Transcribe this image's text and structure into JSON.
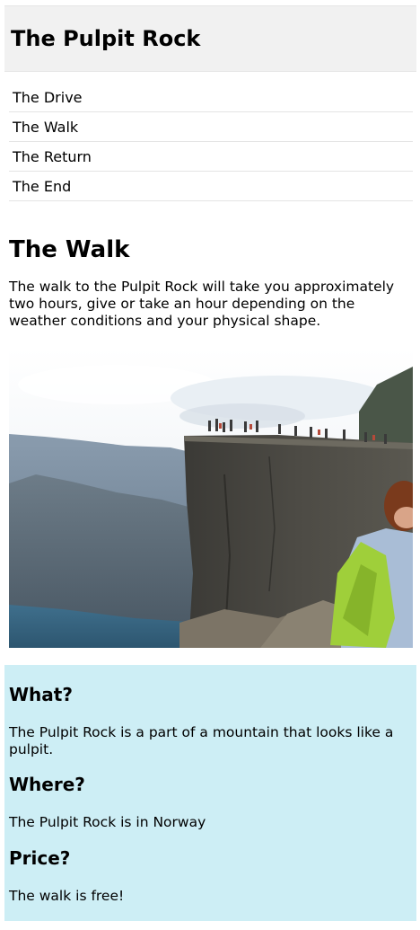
{
  "header": {
    "title": "The Pulpit Rock"
  },
  "nav": {
    "items": [
      {
        "label": "The Drive"
      },
      {
        "label": "The Walk"
      },
      {
        "label": "The Return"
      },
      {
        "label": "The End"
      }
    ]
  },
  "main": {
    "title": "The Walk",
    "text": "The walk to the Pulpit Rock will take you approximately two hours, give or take an hour depending on the weather conditions and your physical shape."
  },
  "aside": {
    "sections": [
      {
        "heading": "What?",
        "text": "The Pulpit Rock is a part of a mountain that looks like a pulpit."
      },
      {
        "heading": "Where?",
        "text": "The Pulpit Rock is in Norway"
      },
      {
        "heading": "Price?",
        "text": "The walk is free!"
      }
    ]
  },
  "colors": {
    "header_bg": "#f1f1f1",
    "aside_bg": "#cdeef5"
  }
}
